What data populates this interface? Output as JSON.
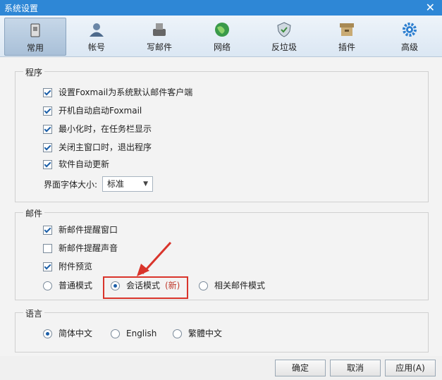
{
  "window": {
    "title": "系统设置"
  },
  "tabs": [
    {
      "label": "常用",
      "icon": "general-icon"
    },
    {
      "label": "帐号",
      "icon": "user-icon"
    },
    {
      "label": "写邮件",
      "icon": "compose-icon"
    },
    {
      "label": "网络",
      "icon": "globe-icon"
    },
    {
      "label": "反垃圾",
      "icon": "shield-icon"
    },
    {
      "label": "插件",
      "icon": "plugin-box-icon"
    },
    {
      "label": "高级",
      "icon": "gear-icon"
    }
  ],
  "program": {
    "label": "程序",
    "options": [
      {
        "label": "设置Foxmail为系统默认邮件客户端",
        "checked": true
      },
      {
        "label": "开机自动启动Foxmail",
        "checked": true
      },
      {
        "label": "最小化时，在任务栏显示",
        "checked": true
      },
      {
        "label": "关闭主窗口时，退出程序",
        "checked": true
      },
      {
        "label": "软件自动更新",
        "checked": true
      }
    ],
    "font_size_label": "界面字体大小:",
    "font_size_value": "标准"
  },
  "mail": {
    "label": "邮件",
    "options": [
      {
        "label": "新邮件提醒窗口",
        "checked": true
      },
      {
        "label": "新邮件提醒声音",
        "checked": false
      },
      {
        "label": "附件预览",
        "checked": true
      }
    ],
    "modes": [
      {
        "label": "普通模式",
        "selected": false
      },
      {
        "label": "会话模式",
        "badge": "(新)",
        "selected": true
      },
      {
        "label": "相关邮件模式",
        "selected": false
      }
    ]
  },
  "language": {
    "label": "语言",
    "options": [
      {
        "label": "简体中文",
        "selected": true
      },
      {
        "label": "English",
        "selected": false
      },
      {
        "label": "繁體中文",
        "selected": false
      }
    ]
  },
  "buttons": {
    "ok": "确定",
    "cancel": "取消",
    "apply": "应用(A)"
  },
  "colors": {
    "titlebar": "#2e87d6",
    "highlight": "#d9342b",
    "badge": "#c0392b"
  }
}
